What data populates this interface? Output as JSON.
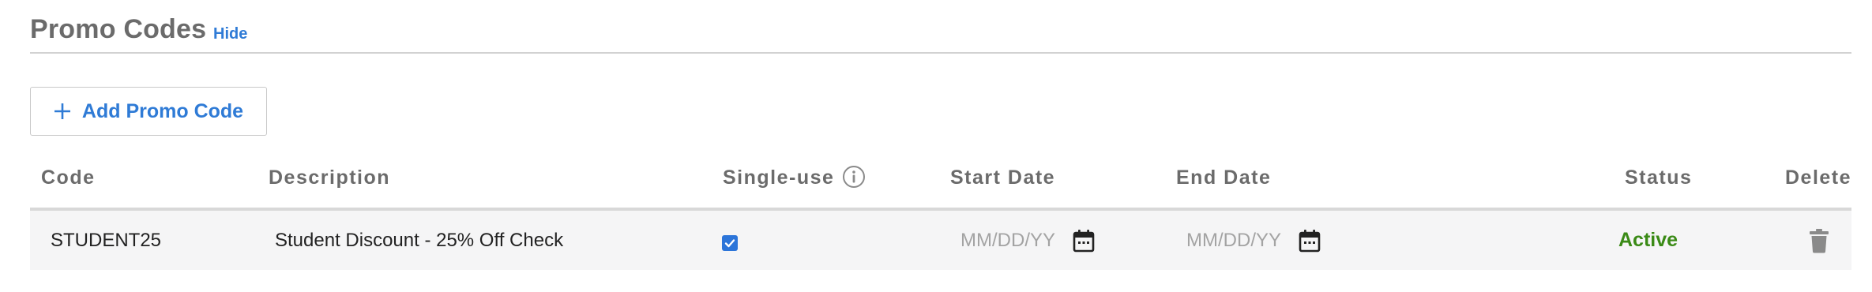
{
  "section": {
    "title": "Promo Codes",
    "hide_label": "Hide"
  },
  "add_button": {
    "label": "Add Promo Code",
    "icon": "plus-icon"
  },
  "table": {
    "headers": {
      "code": "Code",
      "description": "Description",
      "single_use": "Single-use",
      "start_date": "Start Date",
      "end_date": "End Date",
      "status": "Status",
      "delete": "Delete"
    },
    "rows": [
      {
        "code": "STUDENT25",
        "description": "Student Discount - 25% Off Check",
        "single_use": true,
        "start_date_placeholder": "MM/DD/YY",
        "end_date_placeholder": "MM/DD/YY",
        "status": "Active"
      }
    ]
  },
  "colors": {
    "accent": "#2f7bd6",
    "status_active": "#3a8a16",
    "header_text": "#6b6b6b",
    "row_bg": "#f5f5f6"
  },
  "icons": {
    "info": "info-icon",
    "calendar": "calendar-icon",
    "delete": "trash-icon",
    "check": "checkmark-icon"
  }
}
